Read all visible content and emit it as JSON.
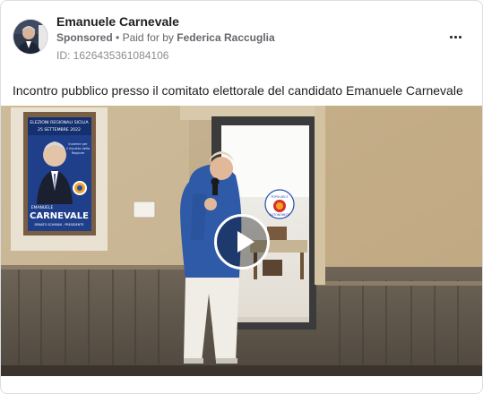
{
  "post": {
    "author_name": "Emanuele Carnevale",
    "sponsored_label": "Sponsored",
    "separator": "•",
    "paid_for_prefix": "Paid for by",
    "paid_for_name": "Federica Raccuglia",
    "ad_id": "ID: 1626435361084106",
    "caption": "Incontro pubblico presso il comitato elettorale del candidato Emanuele Carnevale"
  },
  "media": {
    "type": "video",
    "play_icon": "play-icon",
    "poster": {
      "line1": "ELEZIONI REGIONALI SICILIA",
      "line2": "25 SETTEMBRE 2022",
      "slogan_1": "Insieme per",
      "slogan_2": "il riscatto della",
      "slogan_3": "Regione",
      "first_name": "EMANUELE",
      "surname": "CARNEVALE",
      "footer": "RENATO SCHIFANI - PRESIDENTE"
    },
    "window_logo_1": "POPOLARI E",
    "window_logo_2": "AUTONOMISTI"
  },
  "header": {
    "more_icon": "more-horizontal-icon"
  },
  "colors": {
    "accent": "#1877f2",
    "secondary_text": "#65676b",
    "border": "#dadde1"
  }
}
